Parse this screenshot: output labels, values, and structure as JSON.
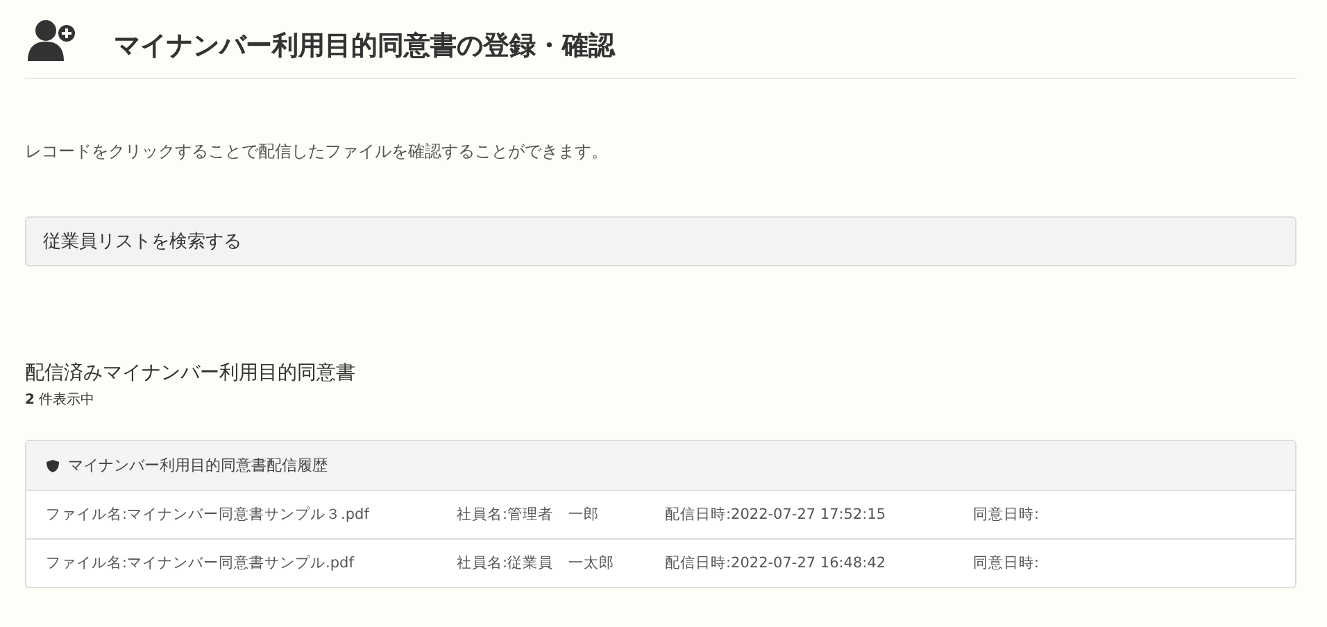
{
  "page": {
    "title": "マイナンバー利用目的同意書の登録・確認"
  },
  "intro": "レコードをクリックすることで配信したファイルを確認することができます。",
  "search_panel": {
    "label": "従業員リストを検索する"
  },
  "section": {
    "title": "配信済みマイナンバー利用目的同意書",
    "count": "**2** 件表示中"
  },
  "history_panel": {
    "title": "マイナンバー利用目的同意書配信履歴",
    "rows": [
      {
        "file": "ファイル名:マイナンバー同意書サンプル３.pdf",
        "employee": "社員名:管理者　一郎",
        "sent": "配信日時:2022-07-27 17:52:15",
        "agreed": "同意日時:"
      },
      {
        "file": "ファイル名:マイナンバー同意書サンプル.pdf",
        "employee": "社員名:従業員　一太郎",
        "sent": "配信日時:2022-07-27 16:48:42",
        "agreed": "同意日時:"
      }
    ]
  }
}
